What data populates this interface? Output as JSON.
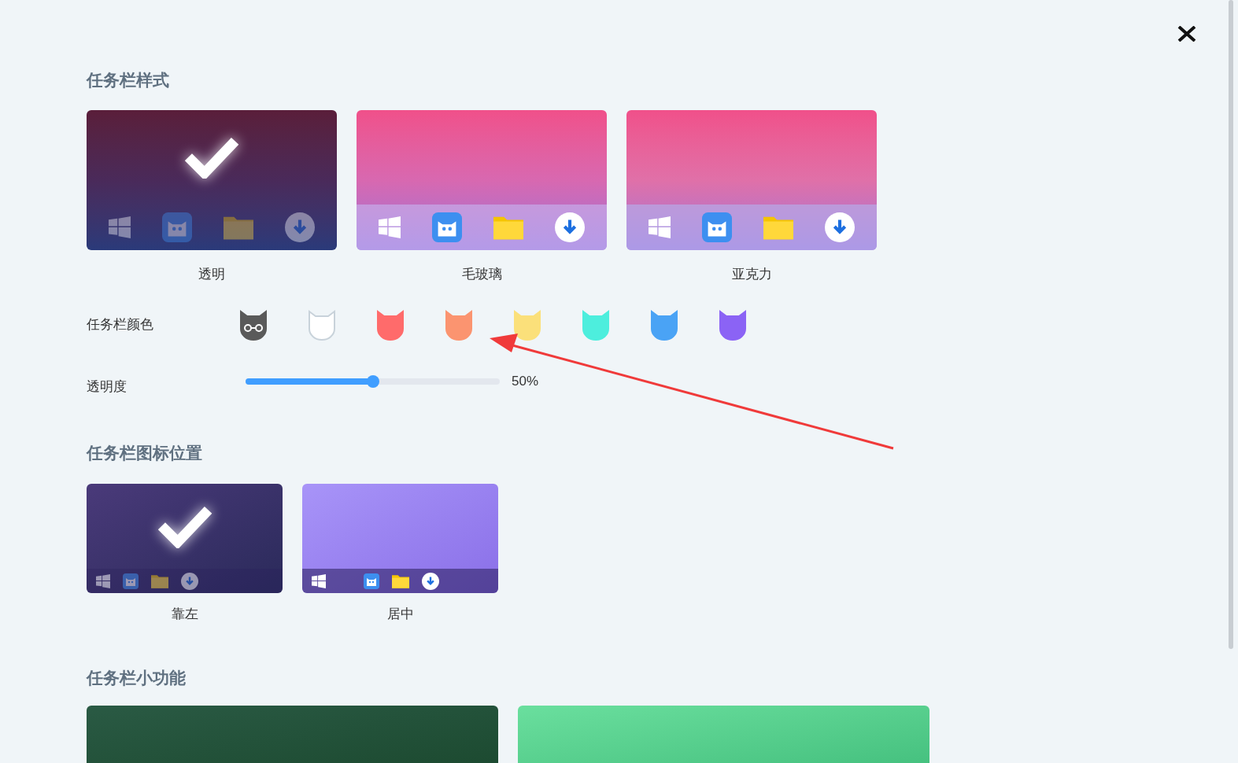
{
  "settings": {
    "style_section": {
      "title": "任务栏样式",
      "options": [
        {
          "label": "透明",
          "kind": "transparent",
          "selected": true
        },
        {
          "label": "毛玻璃",
          "kind": "frosted",
          "selected": false
        },
        {
          "label": "亚克力",
          "kind": "acrylic",
          "selected": false
        }
      ]
    },
    "color_row": {
      "label": "任务栏颜色",
      "swatches": [
        {
          "color": "#5a5a5a",
          "selected": true
        },
        {
          "color": "#ffffff",
          "selected": false
        },
        {
          "color": "#ff6b6b",
          "selected": false
        },
        {
          "color": "#fb9470",
          "selected": false
        },
        {
          "color": "#fbe07a",
          "selected": false
        },
        {
          "color": "#4deedd",
          "selected": false
        },
        {
          "color": "#4aa3f5",
          "selected": false
        },
        {
          "color": "#8b63f5",
          "selected": false
        }
      ]
    },
    "opacity_row": {
      "label": "透明度",
      "level": 0.5,
      "reading": "50%"
    },
    "position_section": {
      "title": "任务栏图标位置",
      "options": [
        {
          "label": "靠左",
          "kind": "left",
          "selected": true
        },
        {
          "label": "居中",
          "kind": "center",
          "selected": false
        }
      ]
    },
    "extras_section": {
      "title": "任务栏小功能"
    }
  }
}
